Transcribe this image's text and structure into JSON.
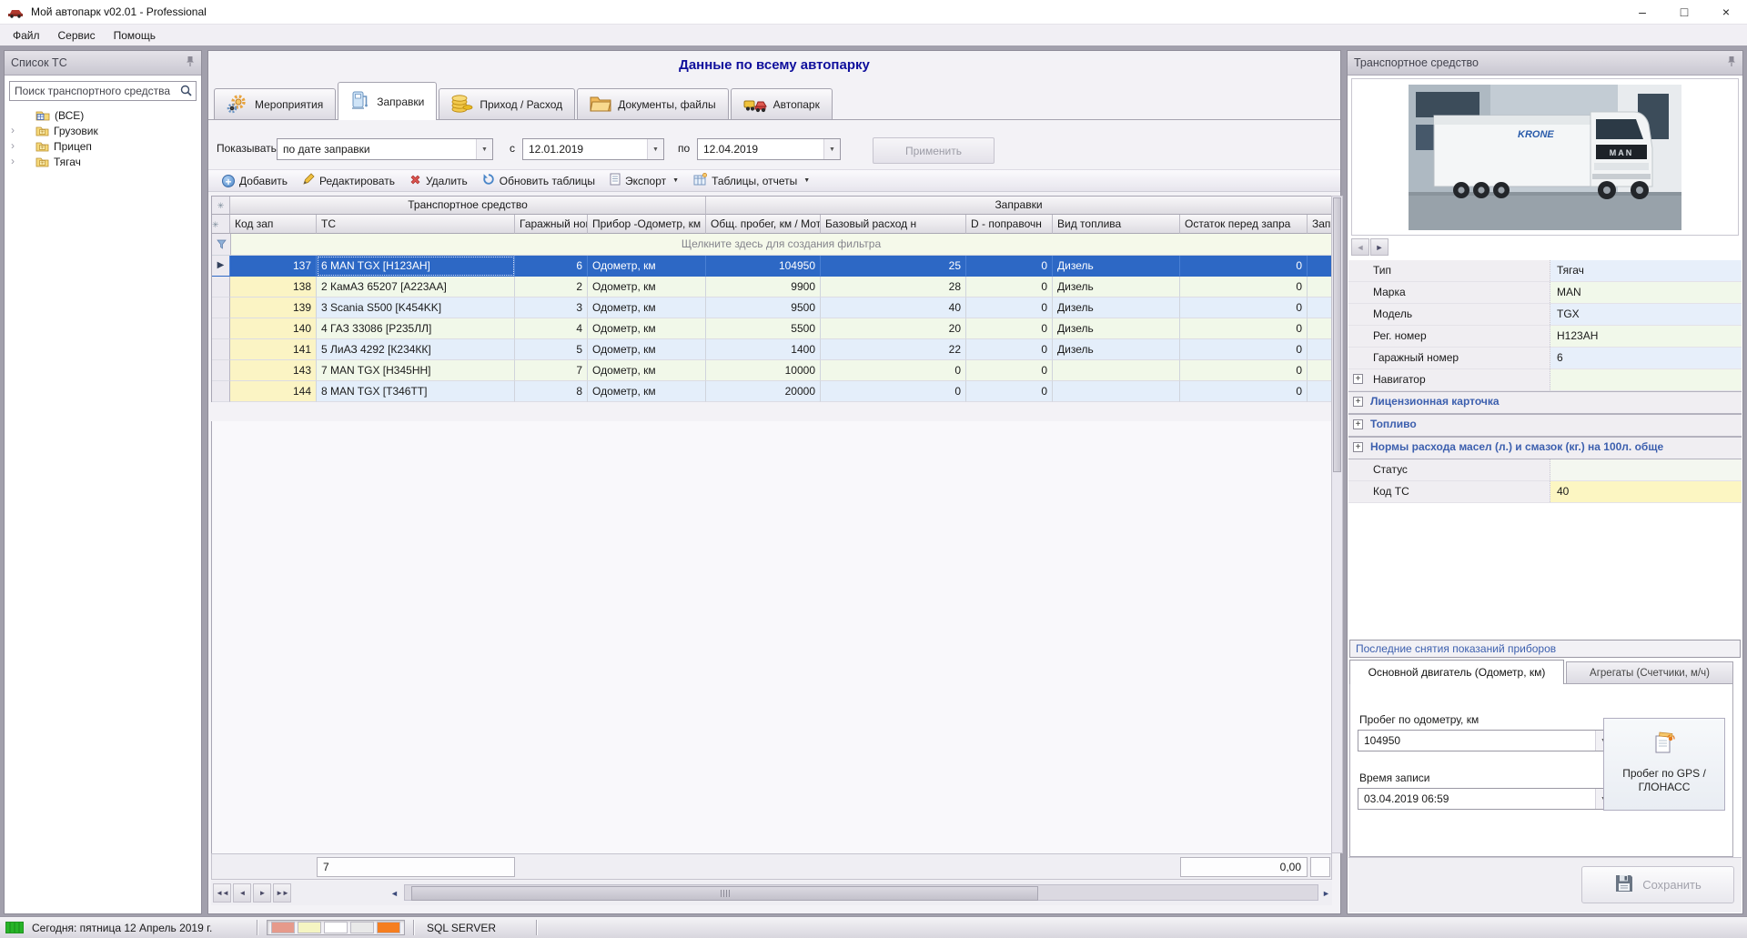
{
  "window": {
    "title": "Мой автопарк v02.01 - Professional",
    "minimize": "–",
    "maximize": "□",
    "close": "×"
  },
  "menu": {
    "items": [
      "Файл",
      "Сервис",
      "Помощь"
    ]
  },
  "icons": {
    "dropdown": "▼",
    "asterisk": "✳",
    "row_arrow": "▶",
    "chevron": "›",
    "plus": "+",
    "left": "◄",
    "right": "►",
    "first": "◄◄",
    "prev": "◄",
    "next": "►",
    "last": "►►"
  },
  "left_panel": {
    "title": "Список ТС",
    "search_placeholder": "Поиск транспортного средства",
    "tree": [
      {
        "label": "(ВСЕ)"
      },
      {
        "label": "Грузовик"
      },
      {
        "label": "Прицеп"
      },
      {
        "label": "Тягач"
      }
    ]
  },
  "main": {
    "title": "Данные по всему автопарку",
    "tabs": [
      {
        "label": "Мероприятия"
      },
      {
        "label": "Заправки"
      },
      {
        "label": "Приход / Расход"
      },
      {
        "label": "Документы, файлы"
      },
      {
        "label": "Автопарк"
      }
    ],
    "filter": {
      "label": "Показывать",
      "mode": "по дате заправки",
      "from_label": "с",
      "from_value": "12.01.2019",
      "to_label": "по",
      "to_value": "12.04.2019",
      "apply": "Применить"
    },
    "toolbar": {
      "add": "Добавить",
      "edit": "Редактировать",
      "remove": "Удалить",
      "refresh": "Обновить таблицы",
      "export": "Экспорт",
      "reports": "Таблицы, отчеты"
    },
    "grid": {
      "bands": [
        "Транспортное средство",
        "Заправки"
      ],
      "columns": [
        "Код зап",
        "ТС",
        "Гаражный ном",
        "Прибор -Одометр, км",
        "Общ. пробег, км / Мот",
        "Базовый расход н",
        "D - поправочн",
        "Вид топлива",
        "Остаток перед запра",
        "Запр"
      ],
      "filter_hint": "Щелкните здесь для создания фильтра",
      "rows": [
        {
          "code": "137",
          "ts": "6 MAN TGX [H123AH]",
          "garage": "6",
          "device": "Одометр, км",
          "mileage": "104950",
          "base": "25",
          "d": "0",
          "fuel": "Дизель",
          "rest": "0"
        },
        {
          "code": "138",
          "ts": "2 КамАЗ 65207 [A223AA]",
          "garage": "2",
          "device": "Одометр, км",
          "mileage": "9900",
          "base": "28",
          "d": "0",
          "fuel": "Дизель",
          "rest": "0"
        },
        {
          "code": "139",
          "ts": "3 Scania S500 [K454KK]",
          "garage": "3",
          "device": "Одометр, км",
          "mileage": "9500",
          "base": "40",
          "d": "0",
          "fuel": "Дизель",
          "rest": "0"
        },
        {
          "code": "140",
          "ts": "4 ГАЗ 33086 [Р235ЛЛ]",
          "garage": "4",
          "device": "Одометр, км",
          "mileage": "5500",
          "base": "20",
          "d": "0",
          "fuel": "Дизель",
          "rest": "0"
        },
        {
          "code": "141",
          "ts": "5 ЛиАЗ 4292 [К234КК]",
          "garage": "5",
          "device": "Одометр, км",
          "mileage": "1400",
          "base": "22",
          "d": "0",
          "fuel": "Дизель",
          "rest": "0"
        },
        {
          "code": "143",
          "ts": "7 MAN TGX [H345HH]",
          "garage": "7",
          "device": "Одометр, км",
          "mileage": "10000",
          "base": "0",
          "d": "0",
          "fuel": "",
          "rest": "0"
        },
        {
          "code": "144",
          "ts": "8 MAN TGX [T346TT]",
          "garage": "8",
          "device": "Одометр, км",
          "mileage": "20000",
          "base": "0",
          "d": "0",
          "fuel": "",
          "rest": "0"
        }
      ],
      "summary_count": "7",
      "summary_total": "0,00"
    }
  },
  "right_panel": {
    "title": "Транспортное средство",
    "truck_brand": "MAN",
    "properties": {
      "type_label": "Тип",
      "type_value": "Тягач",
      "brand_label": "Марка",
      "brand_value": "MAN",
      "model_label": "Модель",
      "model_value": "TGX",
      "reg_label": "Рег. номер",
      "reg_value": "H123AH",
      "garage_label": "Гаражный номер",
      "garage_value": "6",
      "navigator_label": "Навигатор",
      "license_label": "Лицензионная карточка",
      "fuel_label": "Топливо",
      "norms_label": "Нормы расхода масел (л.) и смазок (кг.) на 100л. обще",
      "status_label": "Статус",
      "status_value": "",
      "code_label": "Код ТС",
      "code_value": "40"
    },
    "readings": {
      "title": "Последние снятия показаний приборов",
      "tab_main": "Основной двигатель (Одометр, км)",
      "tab_aux": "Агрегаты (Счетчики, м/ч)",
      "odometer_label": "Пробег по одометру, км",
      "odometer_value": "104950",
      "time_label": "Время записи",
      "time_value": "03.04.2019 06:59",
      "gps_button": "Пробег по GPS / ГЛОНАСС",
      "save": "Сохранить"
    }
  },
  "status_bar": {
    "today": "Сегодня: пятница 12 Апрель 2019 г.",
    "db": "SQL SERVER",
    "legend": [
      "#e69a8b",
      "#f5f5c2",
      "#ffffff",
      "#e9e9e9",
      "#f57e20"
    ]
  }
}
